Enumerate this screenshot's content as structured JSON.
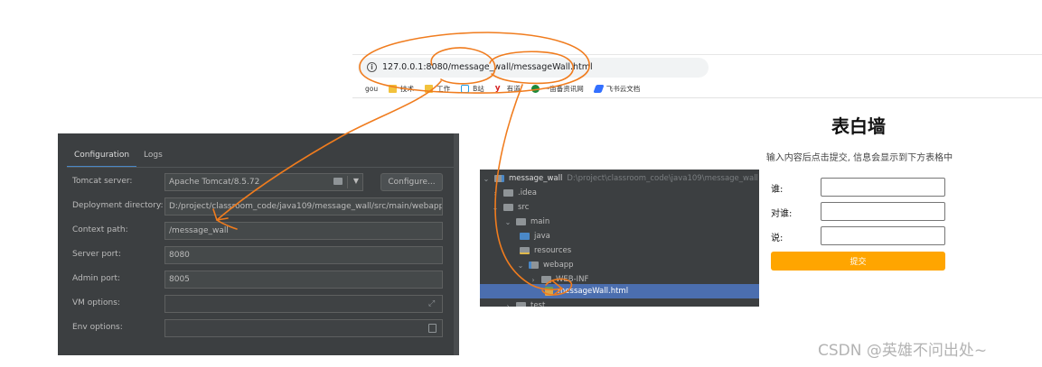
{
  "browser": {
    "url": "127.0.0.1:8080/message_wall/messageWall.html",
    "bookmarks": [
      {
        "label": "gou",
        "icon": "none"
      },
      {
        "label": "技术",
        "icon": "folder-icon"
      },
      {
        "label": "工作",
        "icon": "folder-icon"
      },
      {
        "label": "B站",
        "icon": "bilibili-icon"
      },
      {
        "label": "有道",
        "icon": "youdao-icon"
      },
      {
        "label": "一亩备资讯网",
        "icon": "globe-icon"
      },
      {
        "label": "飞书云文档",
        "icon": "feishu-icon"
      }
    ]
  },
  "ide": {
    "tabs": [
      {
        "label": "Configuration",
        "active": true
      },
      {
        "label": "Logs",
        "active": false
      }
    ],
    "fields": {
      "tomcat_server": {
        "label": "Tomcat server:",
        "value": "Apache Tomcat/8.5.72"
      },
      "deployment_directory": {
        "label": "Deployment directory:",
        "value": "D:/project/classroom_code/java109/message_wall/src/main/webapp"
      },
      "context_path": {
        "label": "Context path:",
        "value": "/message_wall"
      },
      "server_port": {
        "label": "Server port:",
        "value": "8080"
      },
      "admin_port": {
        "label": "Admin port:",
        "value": "8005"
      },
      "vm_options": {
        "label": "VM options:",
        "value": ""
      },
      "env_options": {
        "label": "Env options:",
        "value": ""
      }
    },
    "configure_label": "Configure...",
    "colors": {
      "background": "#3c3f41",
      "field": "#45494a",
      "text": "#bbbbbb",
      "tab_underline": "#4a88c7"
    }
  },
  "project_tree": {
    "root": {
      "name": "message_wall",
      "path": "D:\\project\\classroom_code\\java109\\message_wall"
    },
    "items": [
      {
        "name": ".idea"
      },
      {
        "name": "src"
      },
      {
        "name": "main"
      },
      {
        "name": "java"
      },
      {
        "name": "resources"
      },
      {
        "name": "webapp"
      },
      {
        "name": "WEB-INF"
      },
      {
        "name": "messageWall.html",
        "selected": true
      },
      {
        "name": "test"
      }
    ],
    "colors": {
      "selection": "#4b6eaf"
    }
  },
  "page": {
    "title": "表白墙",
    "subtitle": "输入内容后点击提交, 信息会显示到下方表格中",
    "form": {
      "from_label": "谁:",
      "to_label": "对谁:",
      "message_label": "说:",
      "from_value": "",
      "to_value": "",
      "message_value": ""
    },
    "submit_label": "提交",
    "colors": {
      "submit": "#ffa500"
    }
  },
  "watermark": "CSDN @英雄不问出处~",
  "annotation_color": "#f07c1e"
}
